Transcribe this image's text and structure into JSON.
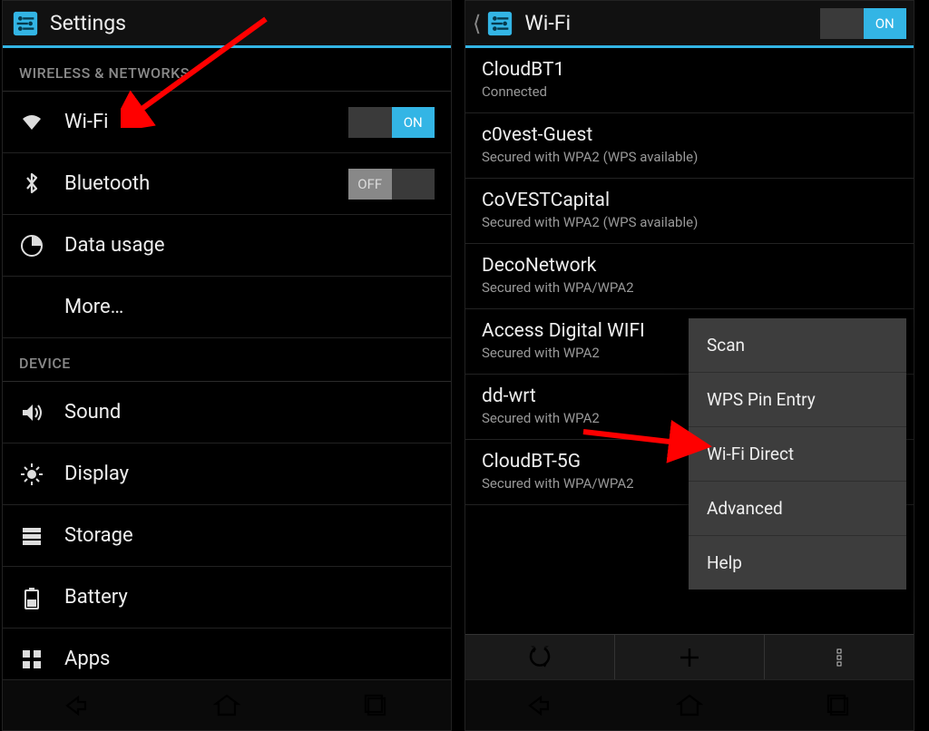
{
  "left": {
    "title": "Settings",
    "sections": {
      "wireless": {
        "header": "WIRELESS & NETWORKS"
      },
      "device": {
        "header": "DEVICE"
      }
    },
    "items": {
      "wifi": {
        "label": "Wi-Fi",
        "toggle": "ON"
      },
      "bluetooth": {
        "label": "Bluetooth",
        "toggle": "OFF"
      },
      "data": {
        "label": "Data usage"
      },
      "more": {
        "label": "More…"
      },
      "sound": {
        "label": "Sound"
      },
      "display": {
        "label": "Display"
      },
      "storage": {
        "label": "Storage"
      },
      "battery": {
        "label": "Battery"
      },
      "apps": {
        "label": "Apps"
      }
    }
  },
  "right": {
    "title": "Wi-Fi",
    "toggle": "ON",
    "networks": [
      {
        "name": "CloudBT1",
        "sub": "Connected",
        "secure": true
      },
      {
        "name": "c0vest-Guest",
        "sub": "Secured with WPA2 (WPS available)",
        "secure": true
      },
      {
        "name": "CoVESTCapital",
        "sub": "Secured with WPA2 (WPS available)",
        "secure": true
      },
      {
        "name": "DecoNetwork",
        "sub": "Secured with WPA/WPA2",
        "secure": true
      },
      {
        "name": "Access Digital WIFI",
        "sub": "Secured with WPA2",
        "secure": true
      },
      {
        "name": "dd-wrt",
        "sub": "Secured with WPA2",
        "secure": true
      },
      {
        "name": "CloudBT-5G",
        "sub": "Secured with WPA/WPA2",
        "secure": true
      }
    ],
    "menu": [
      "Scan",
      "WPS Pin Entry",
      "Wi-Fi Direct",
      "Advanced",
      "Help"
    ]
  },
  "toggle_labels": {
    "on": "ON",
    "off": "OFF"
  }
}
